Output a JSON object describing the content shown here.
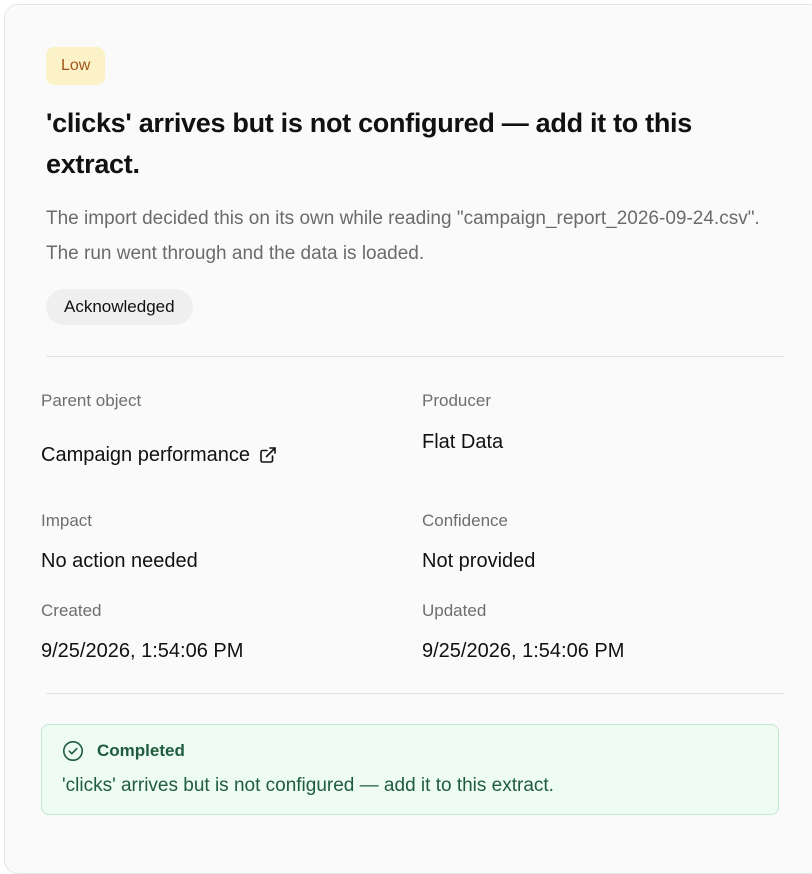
{
  "issue": {
    "severity": "Low",
    "title": "'clicks' arrives but is not configured — add it to this extract.",
    "description": "The import decided this on its own while reading \"campaign_report_2026-09-24.csv\". The run went through and the data is loaded.",
    "status": "Acknowledged"
  },
  "details": {
    "parent_object": {
      "label": "Parent object",
      "value": "Campaign performance"
    },
    "producer": {
      "label": "Producer",
      "value": "Flat Data"
    },
    "impact": {
      "label": "Impact",
      "value": "No action needed"
    },
    "confidence": {
      "label": "Confidence",
      "value": "Not provided"
    },
    "created": {
      "label": "Created",
      "value": "9/25/2026, 1:54:06 PM"
    },
    "updated": {
      "label": "Updated",
      "value": "9/25/2026, 1:54:06 PM"
    }
  },
  "resolution": {
    "title": "Completed",
    "message": "'clicks' arrives but is not configured — add it to this extract."
  },
  "icons": {
    "external_link": "external-link-icon",
    "completed": "check-circle-icon"
  },
  "colors": {
    "severity_bg": "#fcf2c8",
    "severity_text": "#a0551a",
    "success_bg": "#eefbf3",
    "success_border": "#bfe8cf",
    "success_text": "#1f5c3d"
  }
}
